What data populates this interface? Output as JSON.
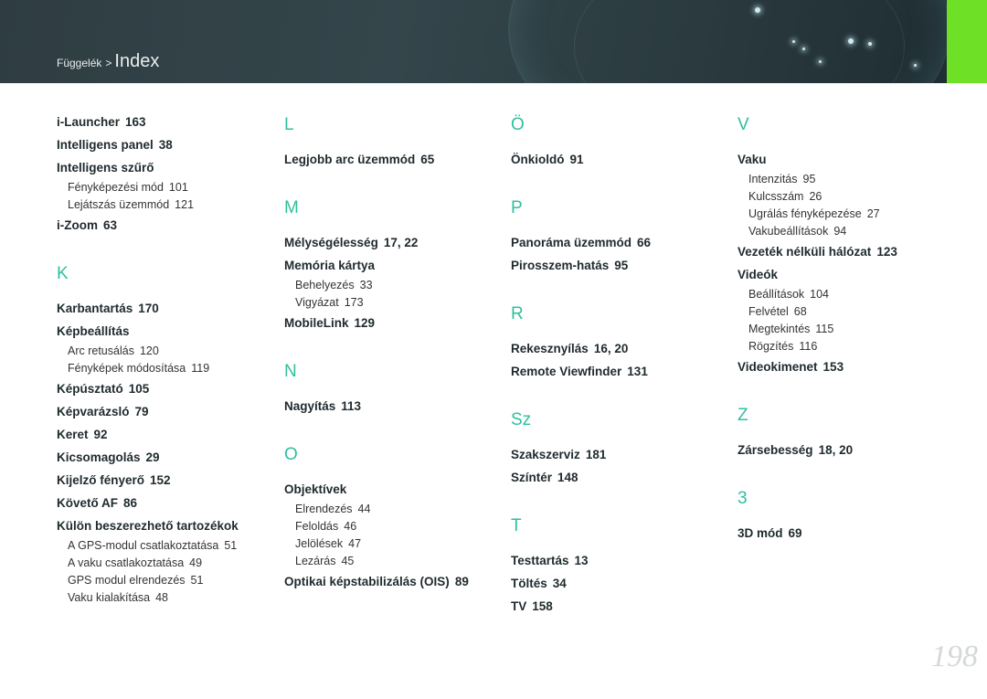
{
  "accent_color": "#2fbf9f",
  "tab_color": "#6ee025",
  "breadcrumb": {
    "parent": "Függelék",
    "separator": ">",
    "current": "Index"
  },
  "page_number": "198",
  "columns": [
    {
      "groups": [
        {
          "letter": "",
          "entries": [
            {
              "label": "i-Launcher",
              "pages": "163"
            },
            {
              "label": "Intelligens panel",
              "pages": "38"
            },
            {
              "label": "Intelligens szűrő",
              "pages": "",
              "subs": [
                {
                  "label": "Fényképezési mód",
                  "pages": "101"
                },
                {
                  "label": "Lejátszás üzemmód",
                  "pages": "121"
                }
              ]
            },
            {
              "label": "i-Zoom",
              "pages": "63"
            }
          ]
        },
        {
          "letter": "K",
          "entries": [
            {
              "label": "Karbantartás",
              "pages": "170"
            },
            {
              "label": "Képbeállítás",
              "pages": "",
              "subs": [
                {
                  "label": "Arc retusálás",
                  "pages": "120"
                },
                {
                  "label": "Fényképek módosítása",
                  "pages": "119"
                }
              ]
            },
            {
              "label": "Képúsztató",
              "pages": "105"
            },
            {
              "label": "Képvarázsló",
              "pages": "79"
            },
            {
              "label": "Keret",
              "pages": "92"
            },
            {
              "label": "Kicsomagolás",
              "pages": "29"
            },
            {
              "label": "Kijelző fényerő",
              "pages": "152"
            },
            {
              "label": "Követő AF",
              "pages": "86"
            },
            {
              "label": "Külön beszerezhető tartozékok",
              "pages": "",
              "subs": [
                {
                  "label": "A GPS-modul csatlakoztatása",
                  "pages": "51"
                },
                {
                  "label": "A vaku csatlakoztatása",
                  "pages": "49"
                },
                {
                  "label": "GPS modul elrendezés",
                  "pages": "51"
                },
                {
                  "label": "Vaku kialakítása",
                  "pages": "48"
                }
              ]
            }
          ]
        }
      ]
    },
    {
      "groups": [
        {
          "letter": "L",
          "entries": [
            {
              "label": "Legjobb arc üzemmód",
              "pages": "65"
            }
          ]
        },
        {
          "letter": "M",
          "entries": [
            {
              "label": "Mélységélesség",
              "pages": "17, 22"
            },
            {
              "label": "Memória kártya",
              "pages": "",
              "subs": [
                {
                  "label": "Behelyezés",
                  "pages": "33"
                },
                {
                  "label": "Vigyázat",
                  "pages": "173"
                }
              ]
            },
            {
              "label": "MobileLink",
              "pages": "129"
            }
          ]
        },
        {
          "letter": "N",
          "entries": [
            {
              "label": "Nagyítás",
              "pages": "113"
            }
          ]
        },
        {
          "letter": "O",
          "entries": [
            {
              "label": "Objektívek",
              "pages": "",
              "subs": [
                {
                  "label": "Elrendezés",
                  "pages": "44"
                },
                {
                  "label": "Feloldás",
                  "pages": "46"
                },
                {
                  "label": "Jelölések",
                  "pages": "47"
                },
                {
                  "label": "Lezárás",
                  "pages": "45"
                }
              ]
            },
            {
              "label": "Optikai képstabilizálás (OIS)",
              "pages": "89"
            }
          ]
        }
      ]
    },
    {
      "groups": [
        {
          "letter": "Ö",
          "entries": [
            {
              "label": "Önkioldó",
              "pages": "91"
            }
          ]
        },
        {
          "letter": "P",
          "entries": [
            {
              "label": "Panoráma üzemmód",
              "pages": "66"
            },
            {
              "label": "Pirosszem-hatás",
              "pages": "95"
            }
          ]
        },
        {
          "letter": "R",
          "entries": [
            {
              "label": "Rekesznyílás",
              "pages": "16, 20"
            },
            {
              "label": "Remote Viewfinder",
              "pages": "131"
            }
          ]
        },
        {
          "letter": "Sz",
          "entries": [
            {
              "label": "Szakszerviz",
              "pages": "181"
            },
            {
              "label": "Színtér",
              "pages": "148"
            }
          ]
        },
        {
          "letter": "T",
          "entries": [
            {
              "label": "Testtartás",
              "pages": "13"
            },
            {
              "label": "Töltés",
              "pages": "34"
            },
            {
              "label": "TV",
              "pages": "158"
            }
          ]
        }
      ]
    },
    {
      "groups": [
        {
          "letter": "V",
          "entries": [
            {
              "label": "Vaku",
              "pages": "",
              "subs": [
                {
                  "label": "Intenzitás",
                  "pages": "95"
                },
                {
                  "label": "Kulcsszám",
                  "pages": "26"
                },
                {
                  "label": "Ugrálás fényképezése",
                  "pages": "27"
                },
                {
                  "label": "Vakubeállítások",
                  "pages": "94"
                }
              ]
            },
            {
              "label": "Vezeték nélküli hálózat",
              "pages": "123"
            },
            {
              "label": "Videók",
              "pages": "",
              "subs": [
                {
                  "label": "Beállítások",
                  "pages": "104"
                },
                {
                  "label": "Felvétel",
                  "pages": "68"
                },
                {
                  "label": "Megtekintés",
                  "pages": "115"
                },
                {
                  "label": "Rögzítés",
                  "pages": "116"
                }
              ]
            },
            {
              "label": "Videokimenet",
              "pages": "153"
            }
          ]
        },
        {
          "letter": "Z",
          "entries": [
            {
              "label": "Zársebesség",
              "pages": "18, 20"
            }
          ]
        },
        {
          "letter": "3",
          "entries": [
            {
              "label": "3D mód",
              "pages": "69"
            }
          ]
        }
      ]
    }
  ]
}
